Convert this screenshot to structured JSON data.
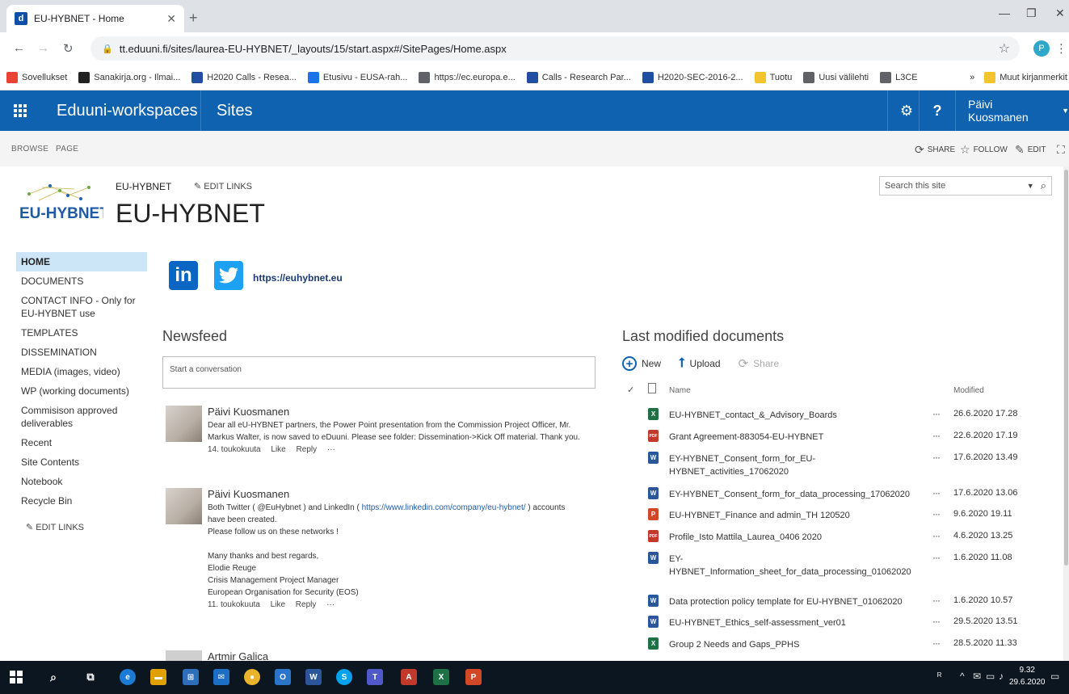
{
  "browser": {
    "tab_title": "EU-HYBNET - Home",
    "tab_favicon_letter": "d",
    "url": "tt.eduuni.fi/sites/laurea-EU-HYBNET/_layouts/15/start.aspx#/SitePages/Home.aspx",
    "profile_initial": "P",
    "bookmarks": [
      {
        "label": "Sovellukset",
        "icon": "apps-grid-icon",
        "color": "#ea4335"
      },
      {
        "label": "Sanakirja.org - Ilmai...",
        "icon": "s-logo-icon",
        "color": "#222222"
      },
      {
        "label": "H2020 Calls - Resea...",
        "icon": "eu-flag-icon",
        "color": "#1f4ea3"
      },
      {
        "label": "Etusivu - EUSA-rah...",
        "icon": "eusa-icon",
        "color": "#1a73e8"
      },
      {
        "label": "https://ec.europa.e...",
        "icon": "globe-icon",
        "color": "#5f6368"
      },
      {
        "label": "Calls - Research Par...",
        "icon": "eu-flag-icon",
        "color": "#1f4ea3"
      },
      {
        "label": "H2020-SEC-2016-2...",
        "icon": "eu-flag-icon",
        "color": "#1f4ea3"
      },
      {
        "label": "Tuotu",
        "icon": "folder-icon",
        "color": "#f4c430"
      },
      {
        "label": "Uusi välilehti",
        "icon": "globe-icon",
        "color": "#5f6368"
      },
      {
        "label": "L3CE",
        "icon": "globe-icon",
        "color": "#5f6368"
      }
    ],
    "bookmarks_overflow": "»",
    "other_bookmarks": "Muut kirjanmerkit"
  },
  "suitebar": {
    "brand": "Eduuni-workspaces",
    "sites": "Sites",
    "user": "Päivi Kuosmanen",
    "bg_color": "#0f62b0"
  },
  "ribbon": {
    "tabs": [
      "BROWSE",
      "PAGE"
    ],
    "share": "SHARE",
    "follow": "FOLLOW",
    "edit": "EDIT"
  },
  "site": {
    "logo_text": "EU-HYBNET",
    "breadcrumb_link": "EU-HYBNET",
    "edit_links": "EDIT LINKS",
    "title": "EU-HYBNET",
    "search_placeholder": "Search this site"
  },
  "leftnav": {
    "items": [
      {
        "label": "HOME",
        "active": true
      },
      {
        "label": "DOCUMENTS"
      },
      {
        "label": "CONTACT INFO - Only for EU-HYBNET use"
      },
      {
        "label": "TEMPLATES"
      },
      {
        "label": "DISSEMINATION"
      },
      {
        "label": "MEDIA (images, video)"
      },
      {
        "label": "WP (working documents)"
      },
      {
        "label": "Commisison approved deliverables"
      },
      {
        "label": "Recent"
      },
      {
        "label": "Site Contents"
      },
      {
        "label": "Notebook"
      },
      {
        "label": "Recycle Bin"
      }
    ],
    "edit_links": "EDIT LINKS"
  },
  "social": {
    "linkedin_letter": "in",
    "link": "https://euhybnet.eu"
  },
  "newsfeed": {
    "title": "Newsfeed",
    "placeholder": "Start a conversation",
    "like": "Like",
    "reply": "Reply",
    "more": "···",
    "posts": [
      {
        "author": "Päivi Kuosmanen",
        "text_a": "Dear all eU-HYBNET partners, the Power Point presentation from the Commission Project Officer, Mr.",
        "text_b": "Markus Walter, is now saved to eDuuni. Please see folder: Dissemination->Kick Off material. Thank you.",
        "date": "14. toukokuuta"
      },
      {
        "author": "Päivi Kuosmanen",
        "text_a": "Both Twitter ( @EuHybnet ) and LinkedIn (",
        "link": "https://www.linkedin.com/company/eu-hybnet/",
        "text_b": ") accounts",
        "text_c": "have been created.",
        "text_d": "Please follow us on these networks !",
        "text_e": "Many thanks and best regards,",
        "text_f": "Elodie Reuge",
        "text_g": "Crisis Management Project Manager",
        "text_h": "European Organisation for Security (EOS)",
        "date": "11. toukokuuta"
      },
      {
        "author": "Artmir Galica"
      }
    ]
  },
  "documents": {
    "title": "Last modified documents",
    "new": "New",
    "upload": "Upload",
    "share": "Share",
    "col_name": "Name",
    "col_modified": "Modified",
    "more": "···",
    "rows": [
      {
        "name": "EU-HYBNET_contact_&_Advisory_Boards",
        "modified": "26.6.2020 17.28",
        "type": "excel",
        "color": "#1e7145",
        "letter": "X"
      },
      {
        "name": "Grant Agreement-883054-EU-HYBNET",
        "modified": "22.6.2020 17.19",
        "type": "pdf",
        "color": "#c0392b",
        "letter": "PDF"
      },
      {
        "name": "EY-HYBNET_Consent_form_for_EU-",
        "name2": "HYBNET_activities_17062020",
        "modified": "17.6.2020 13.49",
        "type": "word",
        "color": "#2b579a",
        "letter": "W"
      },
      {
        "name": "EY-HYBNET_Consent_form_for_data_processing_17062020",
        "modified": "17.6.2020 13.06",
        "type": "word",
        "color": "#2b579a",
        "letter": "W"
      },
      {
        "name": "EU-HYBNET_Finance and admin_TH 120520",
        "modified": "9.6.2020 19.11",
        "type": "powerpoint",
        "color": "#d24726",
        "letter": "P"
      },
      {
        "name": "Profile_Isto Mattila_Laurea_0406 2020",
        "modified": "4.6.2020 13.25",
        "type": "pdf",
        "color": "#c0392b",
        "letter": "PDF"
      },
      {
        "name": "EY-",
        "name2": "HYBNET_Information_sheet_for_data_processing_01062020",
        "modified": "1.6.2020 11.08",
        "type": "word",
        "color": "#2b579a",
        "letter": "W"
      },
      {
        "name": "Data protection policy template for EU-HYBNET_01062020",
        "modified": "1.6.2020 10.57",
        "type": "word",
        "color": "#2b579a",
        "letter": "W"
      },
      {
        "name": "EU-HYBNET_Ethics_self-assessment_ver01",
        "modified": "29.5.2020 13.51",
        "type": "word",
        "color": "#2b579a",
        "letter": "W"
      },
      {
        "name": "Group 2 Needs and Gaps_PPHS",
        "modified": "28.5.2020 11.33",
        "type": "excel",
        "color": "#1e7145",
        "letter": "X"
      }
    ]
  },
  "taskbar": {
    "time": "9.32",
    "date": "29.6.2020"
  }
}
